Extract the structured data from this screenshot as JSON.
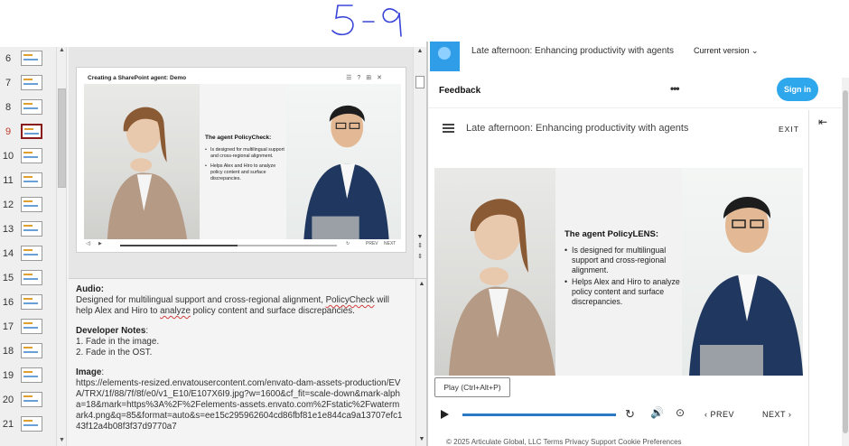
{
  "handwriting": "5-9",
  "editor": {
    "thumbnails": [
      {
        "num": "6",
        "active": false
      },
      {
        "num": "7",
        "active": false
      },
      {
        "num": "8",
        "active": false
      },
      {
        "num": "9",
        "active": true
      },
      {
        "num": "10",
        "active": false
      },
      {
        "num": "11",
        "active": false
      },
      {
        "num": "12",
        "active": false
      },
      {
        "num": "13",
        "active": false
      },
      {
        "num": "14",
        "active": false
      },
      {
        "num": "15",
        "active": false
      },
      {
        "num": "16",
        "active": false
      },
      {
        "num": "17",
        "active": false
      },
      {
        "num": "18",
        "active": false
      },
      {
        "num": "19",
        "active": false
      },
      {
        "num": "20",
        "active": false
      },
      {
        "num": "21",
        "active": false
      }
    ],
    "slide": {
      "title": "Creating a SharePoint agent: Demo",
      "heading": "The agent PolicyCheck:",
      "bullets": [
        "Is designed for multilingual support and cross-regional alignment.",
        "Helps Alex and Hiro to analyze policy content and surface discrepancies."
      ],
      "prev_label": "PREV",
      "next_label": "NEXT"
    },
    "notes": {
      "audio_heading": "Audio:",
      "audio_text_1": "Designed for multilingual support and cross-regional alignment, ",
      "audio_text_policy": "PolicyCheck",
      "audio_text_2": " will help Alex and Hiro to ",
      "audio_text_analyze": "analyze",
      "audio_text_3": " policy content and surface discrepancies.",
      "dev_heading": "Developer Notes",
      "dev_colon": ":",
      "dev_items": [
        "1.   Fade in the image.",
        "2.   Fade in the OST."
      ],
      "image_heading": "Image",
      "image_colon": ":",
      "image_url": "https://elements-resized.envatousercontent.com/envato-dam-assets-production/EVA/TRX/1f/88/7f/8f/e0/v1_E10/E107X6I9.jpg?w=1600&cf_fit=scale-down&mark-alpha=18&mark=https%3A%2F%2Felements-assets.envato.com%2Fstatic%2Fwatermark4.png&q=85&format=auto&s=ee15c295962604cd86fbf81e1e844ca9a13707efc143f12a4b08f3f37d9770a7"
    }
  },
  "player": {
    "topbar_title": "Late afternoon: Enhancing productivity with agents",
    "version": "Current version",
    "feedback": "Feedback",
    "more": "•••",
    "sign_in": "Sign in",
    "course_title": "Late afternoon: Enhancing productivity with agents",
    "exit": "EXIT",
    "slide_heading": "The agent PolicyLENS:",
    "slide_bullets": [
      "Is designed for multilingual support and cross-regional alignment.",
      "Helps Alex and Hiro to analyze policy content and surface discrepancies."
    ],
    "play_tooltip": "Play (Ctrl+Alt+P)",
    "prev": "PREV",
    "next": "NEXT",
    "footer": "© 2025 Articulate Global, LLC   Terms   Privacy   Support   Cookie Preferences"
  },
  "colors": {
    "accent_blue": "#2ea7ec",
    "active_slide": "#8b1a1a",
    "progress": "#2b78c5"
  }
}
